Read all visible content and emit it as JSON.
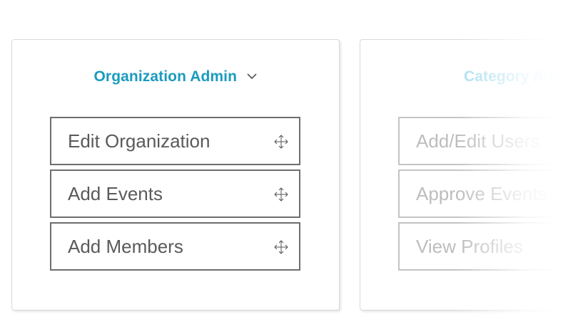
{
  "cards": [
    {
      "title": "Organization Admin",
      "expanded": true,
      "accent": "#1a9bbf",
      "permissions": [
        {
          "label": "Edit Organization",
          "icon": "move-icon"
        },
        {
          "label": "Add Events",
          "icon": "move-icon"
        },
        {
          "label": "Add Members",
          "icon": "move-icon"
        }
      ]
    },
    {
      "title": "Category Ad",
      "faded": true,
      "accent": "#a9def0",
      "permissions": [
        {
          "label": "Add/Edit Users"
        },
        {
          "label": "Approve Events"
        },
        {
          "label": "View Profiles"
        }
      ]
    }
  ]
}
